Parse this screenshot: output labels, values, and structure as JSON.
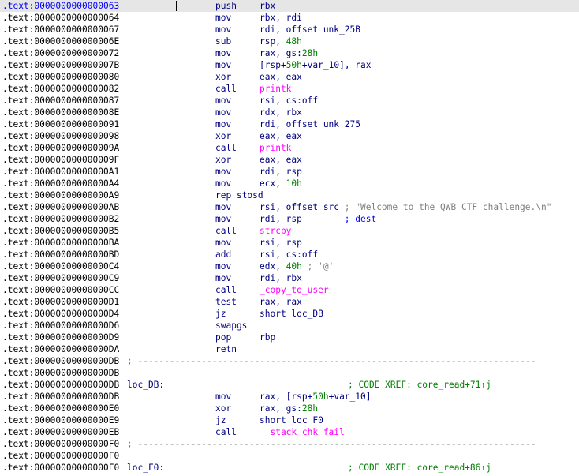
{
  "colors": {
    "background": "#ffffff",
    "address": "#000000",
    "current_address": "#0000ff",
    "current_line_bg": "#e6e6e6",
    "mnemonic": "#000080",
    "number": "#008000",
    "function_call": "#ff00ff",
    "string_comment": "#7f7f7f",
    "comment": "#0000ff",
    "separator": "#7f7f7f"
  },
  "listing": [
    {
      "kind": "insn",
      "addr": ".text:0000000000000063",
      "current": true,
      "mnem": "push",
      "ops": [
        {
          "t": "rbx",
          "c": "reg"
        }
      ]
    },
    {
      "kind": "insn",
      "addr": ".text:0000000000000064",
      "mnem": "mov",
      "ops": [
        {
          "t": "rbx, rdi",
          "c": "reg"
        }
      ]
    },
    {
      "kind": "insn",
      "addr": ".text:0000000000000067",
      "mnem": "mov",
      "ops": [
        {
          "t": "rdi, offset unk_25B",
          "c": "reg"
        }
      ]
    },
    {
      "kind": "insn",
      "addr": ".text:000000000000006E",
      "mnem": "sub",
      "ops": [
        {
          "t": "rsp, ",
          "c": "reg"
        },
        {
          "t": "48h",
          "c": "num"
        }
      ]
    },
    {
      "kind": "insn",
      "addr": ".text:0000000000000072",
      "mnem": "mov",
      "ops": [
        {
          "t": "rax, gs:",
          "c": "reg"
        },
        {
          "t": "28h",
          "c": "num"
        }
      ]
    },
    {
      "kind": "insn",
      "addr": ".text:000000000000007B",
      "mnem": "mov",
      "ops": [
        {
          "t": "[rsp+",
          "c": "reg"
        },
        {
          "t": "50h",
          "c": "num"
        },
        {
          "t": "+",
          "c": "reg"
        },
        {
          "t": "var_10",
          "c": "var"
        },
        {
          "t": "], rax",
          "c": "reg"
        }
      ]
    },
    {
      "kind": "insn",
      "addr": ".text:0000000000000080",
      "mnem": "xor",
      "ops": [
        {
          "t": "eax, eax",
          "c": "reg"
        }
      ]
    },
    {
      "kind": "insn",
      "addr": ".text:0000000000000082",
      "mnem": "call",
      "ops": [
        {
          "t": "printk",
          "c": "func"
        }
      ]
    },
    {
      "kind": "insn",
      "addr": ".text:0000000000000087",
      "mnem": "mov",
      "ops": [
        {
          "t": "rsi, cs:off",
          "c": "reg"
        }
      ]
    },
    {
      "kind": "insn",
      "addr": ".text:000000000000008E",
      "mnem": "mov",
      "ops": [
        {
          "t": "rdx, rbx",
          "c": "reg"
        }
      ]
    },
    {
      "kind": "insn",
      "addr": ".text:0000000000000091",
      "mnem": "mov",
      "ops": [
        {
          "t": "rdi, offset unk_275",
          "c": "reg"
        }
      ]
    },
    {
      "kind": "insn",
      "addr": ".text:0000000000000098",
      "mnem": "xor",
      "ops": [
        {
          "t": "eax, eax",
          "c": "reg"
        }
      ]
    },
    {
      "kind": "insn",
      "addr": ".text:000000000000009A",
      "mnem": "call",
      "ops": [
        {
          "t": "printk",
          "c": "func"
        }
      ]
    },
    {
      "kind": "insn",
      "addr": ".text:000000000000009F",
      "mnem": "xor",
      "ops": [
        {
          "t": "eax, eax",
          "c": "reg"
        }
      ]
    },
    {
      "kind": "insn",
      "addr": ".text:00000000000000A1",
      "mnem": "mov",
      "ops": [
        {
          "t": "rdi, rsp",
          "c": "reg"
        }
      ]
    },
    {
      "kind": "insn",
      "addr": ".text:00000000000000A4",
      "mnem": "mov",
      "ops": [
        {
          "t": "ecx, ",
          "c": "reg"
        },
        {
          "t": "10h",
          "c": "num"
        }
      ]
    },
    {
      "kind": "insn",
      "addr": ".text:00000000000000A9",
      "mnem": "rep stosd",
      "ops": []
    },
    {
      "kind": "insn",
      "addr": ".text:00000000000000AB",
      "mnem": "mov",
      "ops": [
        {
          "t": "rsi, offset src",
          "c": "reg"
        },
        {
          "t": " ; \"Welcome to the QWB CTF challenge.\\n\"",
          "c": "str"
        }
      ]
    },
    {
      "kind": "insn",
      "addr": ".text:00000000000000B2",
      "mnem": "mov",
      "ops": [
        {
          "t": "rdi, rsp",
          "c": "reg"
        },
        {
          "t": "        ; dest",
          "c": "cmt"
        }
      ]
    },
    {
      "kind": "insn",
      "addr": ".text:00000000000000B5",
      "mnem": "call",
      "ops": [
        {
          "t": "strcpy",
          "c": "func"
        }
      ]
    },
    {
      "kind": "insn",
      "addr": ".text:00000000000000BA",
      "mnem": "mov",
      "ops": [
        {
          "t": "rsi, rsp",
          "c": "reg"
        }
      ]
    },
    {
      "kind": "insn",
      "addr": ".text:00000000000000BD",
      "mnem": "add",
      "ops": [
        {
          "t": "rsi, cs:off",
          "c": "reg"
        }
      ]
    },
    {
      "kind": "insn",
      "addr": ".text:00000000000000C4",
      "mnem": "mov",
      "ops": [
        {
          "t": "edx, ",
          "c": "reg"
        },
        {
          "t": "40h",
          "c": "num"
        },
        {
          "t": " ; '@'",
          "c": "str"
        }
      ]
    },
    {
      "kind": "insn",
      "addr": ".text:00000000000000C9",
      "mnem": "mov",
      "ops": [
        {
          "t": "rdi, rbx",
          "c": "reg"
        }
      ]
    },
    {
      "kind": "insn",
      "addr": ".text:00000000000000CC",
      "mnem": "call",
      "ops": [
        {
          "t": "_copy_to_user",
          "c": "func"
        }
      ]
    },
    {
      "kind": "insn",
      "addr": ".text:00000000000000D1",
      "mnem": "test",
      "ops": [
        {
          "t": "rax, rax",
          "c": "reg"
        }
      ]
    },
    {
      "kind": "insn",
      "addr": ".text:00000000000000D4",
      "mnem": "jz",
      "ops": [
        {
          "t": "short loc_DB",
          "c": "reg"
        }
      ]
    },
    {
      "kind": "insn",
      "addr": ".text:00000000000000D6",
      "mnem": "swapgs",
      "ops": []
    },
    {
      "kind": "insn",
      "addr": ".text:00000000000000D9",
      "mnem": "pop",
      "ops": [
        {
          "t": "rbp",
          "c": "reg"
        }
      ]
    },
    {
      "kind": "insn",
      "addr": ".text:00000000000000DA",
      "mnem": "retn",
      "ops": []
    },
    {
      "kind": "sep",
      "addr": ".text:00000000000000DB",
      "text": "; ---------------------------------------------------------------------------"
    },
    {
      "kind": "blank",
      "addr": ".text:00000000000000DB"
    },
    {
      "kind": "label",
      "addr": ".text:00000000000000DB",
      "label": "loc_DB:",
      "xref": "; CODE XREF: core_read+71↑j"
    },
    {
      "kind": "insn",
      "addr": ".text:00000000000000DB",
      "mnem": "mov",
      "ops": [
        {
          "t": "rax, [rsp+",
          "c": "reg"
        },
        {
          "t": "50h",
          "c": "num"
        },
        {
          "t": "+",
          "c": "reg"
        },
        {
          "t": "var_10",
          "c": "var"
        },
        {
          "t": "]",
          "c": "reg"
        }
      ]
    },
    {
      "kind": "insn",
      "addr": ".text:00000000000000E0",
      "mnem": "xor",
      "ops": [
        {
          "t": "rax, gs:",
          "c": "reg"
        },
        {
          "t": "28h",
          "c": "num"
        }
      ]
    },
    {
      "kind": "insn",
      "addr": ".text:00000000000000E9",
      "mnem": "jz",
      "ops": [
        {
          "t": "short loc_F0",
          "c": "reg"
        }
      ]
    },
    {
      "kind": "insn",
      "addr": ".text:00000000000000EB",
      "mnem": "call",
      "ops": [
        {
          "t": "__stack_chk_fail",
          "c": "func"
        }
      ]
    },
    {
      "kind": "sep",
      "addr": ".text:00000000000000F0",
      "text": "; ---------------------------------------------------------------------------"
    },
    {
      "kind": "blank",
      "addr": ".text:00000000000000F0"
    },
    {
      "kind": "label",
      "addr": ".text:00000000000000F0",
      "label": "loc_F0:",
      "xref": "; CODE XREF: core_read+86↑j"
    }
  ]
}
